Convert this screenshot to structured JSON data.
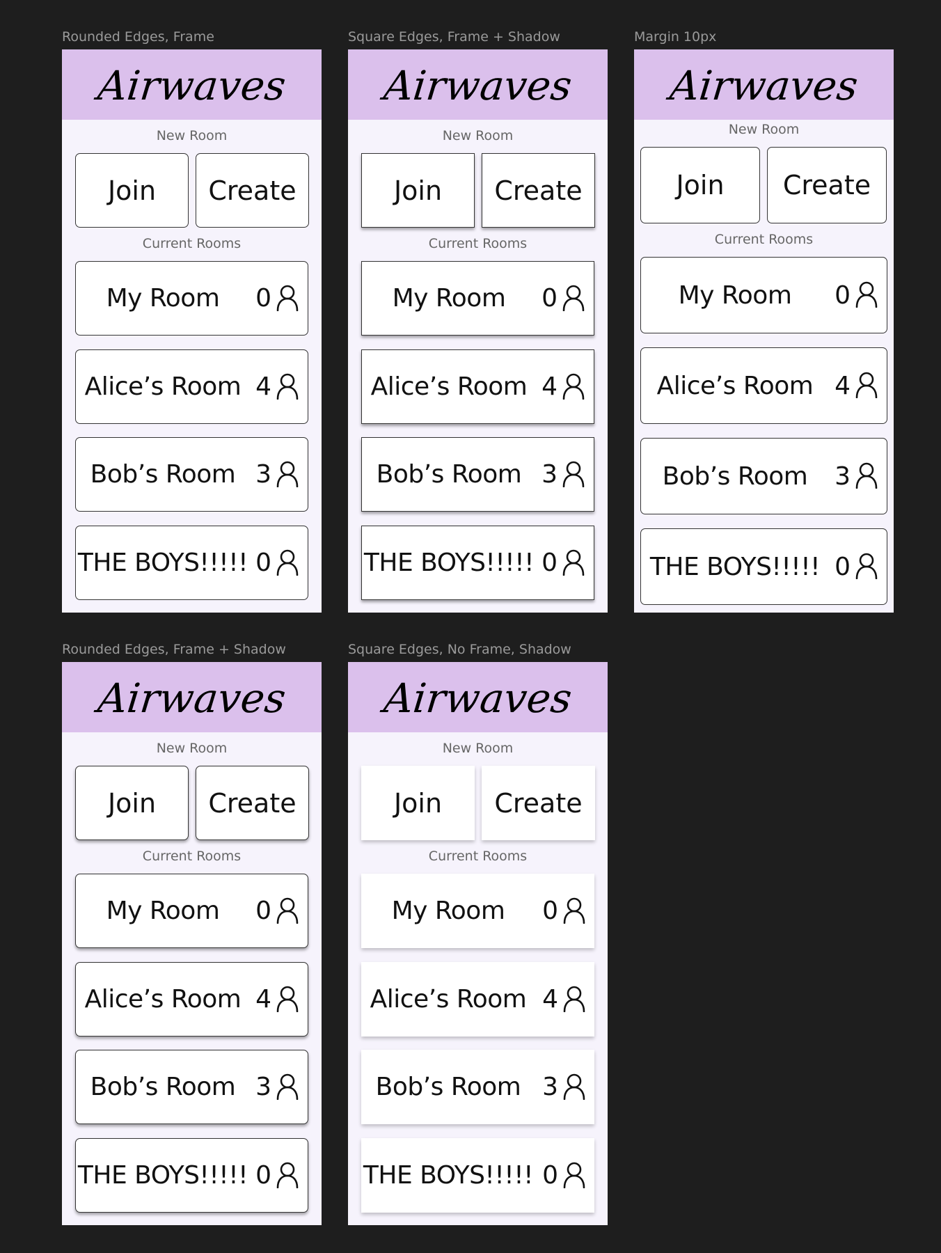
{
  "app": {
    "title": "Airwaves",
    "new_room_label": "New Room",
    "current_rooms_label": "Current Rooms",
    "join_label": "Join",
    "create_label": "Create",
    "user_icon": "person-icon"
  },
  "frames": [
    {
      "caption": "Rounded Edges, Frame"
    },
    {
      "caption": "Square Edges, Frame + Shadow"
    },
    {
      "caption": "Margin 10px"
    },
    {
      "caption": "Rounded Edges, Frame + Shadow"
    },
    {
      "caption": "Square Edges, No Frame, Shadow"
    }
  ],
  "rooms": [
    {
      "name": "My Room",
      "count": "0"
    },
    {
      "name": "Alice’s Room",
      "count": "4"
    },
    {
      "name": "Bob’s Room",
      "count": "3"
    },
    {
      "name": "THE BOYS!!!!!",
      "count": "0"
    }
  ],
  "colors": {
    "background": "#1e1e1e",
    "header": "#dbc0ec",
    "panel": "#f6f3fc",
    "card": "#ffffff",
    "caption": "#9a9a9a"
  }
}
